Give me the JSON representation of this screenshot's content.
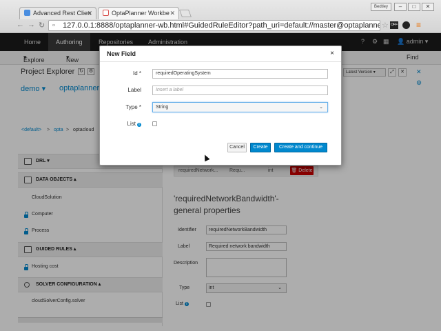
{
  "browser": {
    "tabs": [
      {
        "label": "Advanced Rest Clien",
        "color": "#4a8ee0"
      },
      {
        "label": "OptaPlanner Workbe",
        "color": "#d9534f"
      }
    ],
    "address": "127.0.0.1:8888/optaplanner-wb.html#GuidedRuleEditor?path_uri=default://master@optaplanner-example",
    "window_label": "Bedtley"
  },
  "appbar": {
    "items": [
      "Home",
      "Authoring",
      "Repositories",
      "Administration"
    ],
    "active": "Authoring",
    "user": "admin"
  },
  "toolbar": {
    "explore": "Explore",
    "new": "New",
    "find": "Find"
  },
  "explorer": {
    "title": "Project Explorer",
    "crumb_demo": "demo",
    "crumb_project": "optaplanner",
    "path": [
      "<default>",
      "opta",
      "optacloud"
    ],
    "latest_version": "Latest Version"
  },
  "sections": {
    "drl": "DRL",
    "data_objects": "DATA OBJECTS",
    "guided_rules": "GUIDED RULES",
    "solver": "SOLVER CONFIGURATION"
  },
  "items": {
    "cloud_solution": "CloudSolution",
    "computer": "Computer",
    "process": "Process",
    "hosting_cost": "Hosting cost",
    "solver_config": "cloudSolverConfig.solver"
  },
  "field_row": {
    "id": "requiredNetwork...",
    "label": "Requ...",
    "type": "int",
    "delete": "Delete"
  },
  "props": {
    "title": "'requiredNetworkBandwidth'- general properties",
    "identifier_label": "Identifier",
    "identifier_value": "requiredNetworkBandwidth",
    "label_label": "Label",
    "label_value": "Required network bandwidth",
    "description_label": "Description",
    "type_label": "Type",
    "type_value": "int",
    "list_label": "List"
  },
  "modal": {
    "title": "New Field",
    "id_label": "Id *",
    "id_value": "requiredOperatingSystem",
    "label_label": "Label",
    "label_placeholder": "Insert a label",
    "type_label": "Type *",
    "type_value": "String",
    "list_label": "List",
    "cancel": "Cancel",
    "create": "Create",
    "create_continue": "Create and continue"
  }
}
